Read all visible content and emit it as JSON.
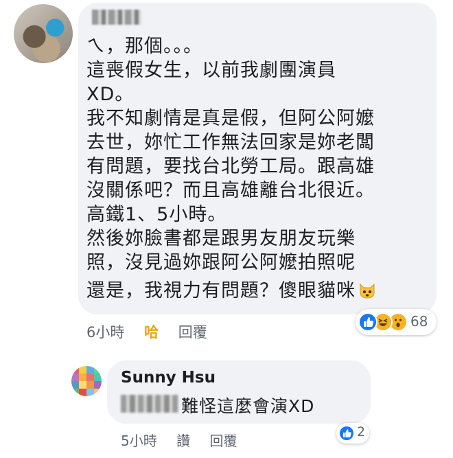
{
  "comment": {
    "lines": [
      "ㄟ，那個。。。",
      "這喪假女生，以前我劇團演員",
      "XD。",
      "我不知劇情是真是假，但阿公阿嬤",
      "去世，妳忙工作無法回家是妳老闆",
      "有問題，要找台北勞工局。跟高雄",
      "沒關係吧？而且高雄離台北很近。",
      "高鐵1、5小時。",
      "然後妳臉書都是跟男友朋友玩樂",
      "照，沒見過妳跟阿公阿嬤拍照呢",
      "還是，我視力有問題？傻眼貓咪"
    ],
    "time": "6小時",
    "reaction_action": "哈",
    "reply_label": "回覆",
    "reaction_count": "68",
    "reaction_icons": [
      "like-icon",
      "haha-icon",
      "wow-icon"
    ],
    "emoji_icon": "cat-face-icon"
  },
  "reply": {
    "author": "Sunny Hsu",
    "text": "難怪這麼會演XD",
    "time": "5小時",
    "like_label": "讚",
    "reply_label": "回覆",
    "reaction_count": "2",
    "reaction_icons": [
      "like-icon"
    ]
  },
  "colors": {
    "bubble": "#f0f2f5",
    "like_blue": "#1877f2",
    "haha_yellow": "#f7b125",
    "action_gray": "#606770"
  }
}
